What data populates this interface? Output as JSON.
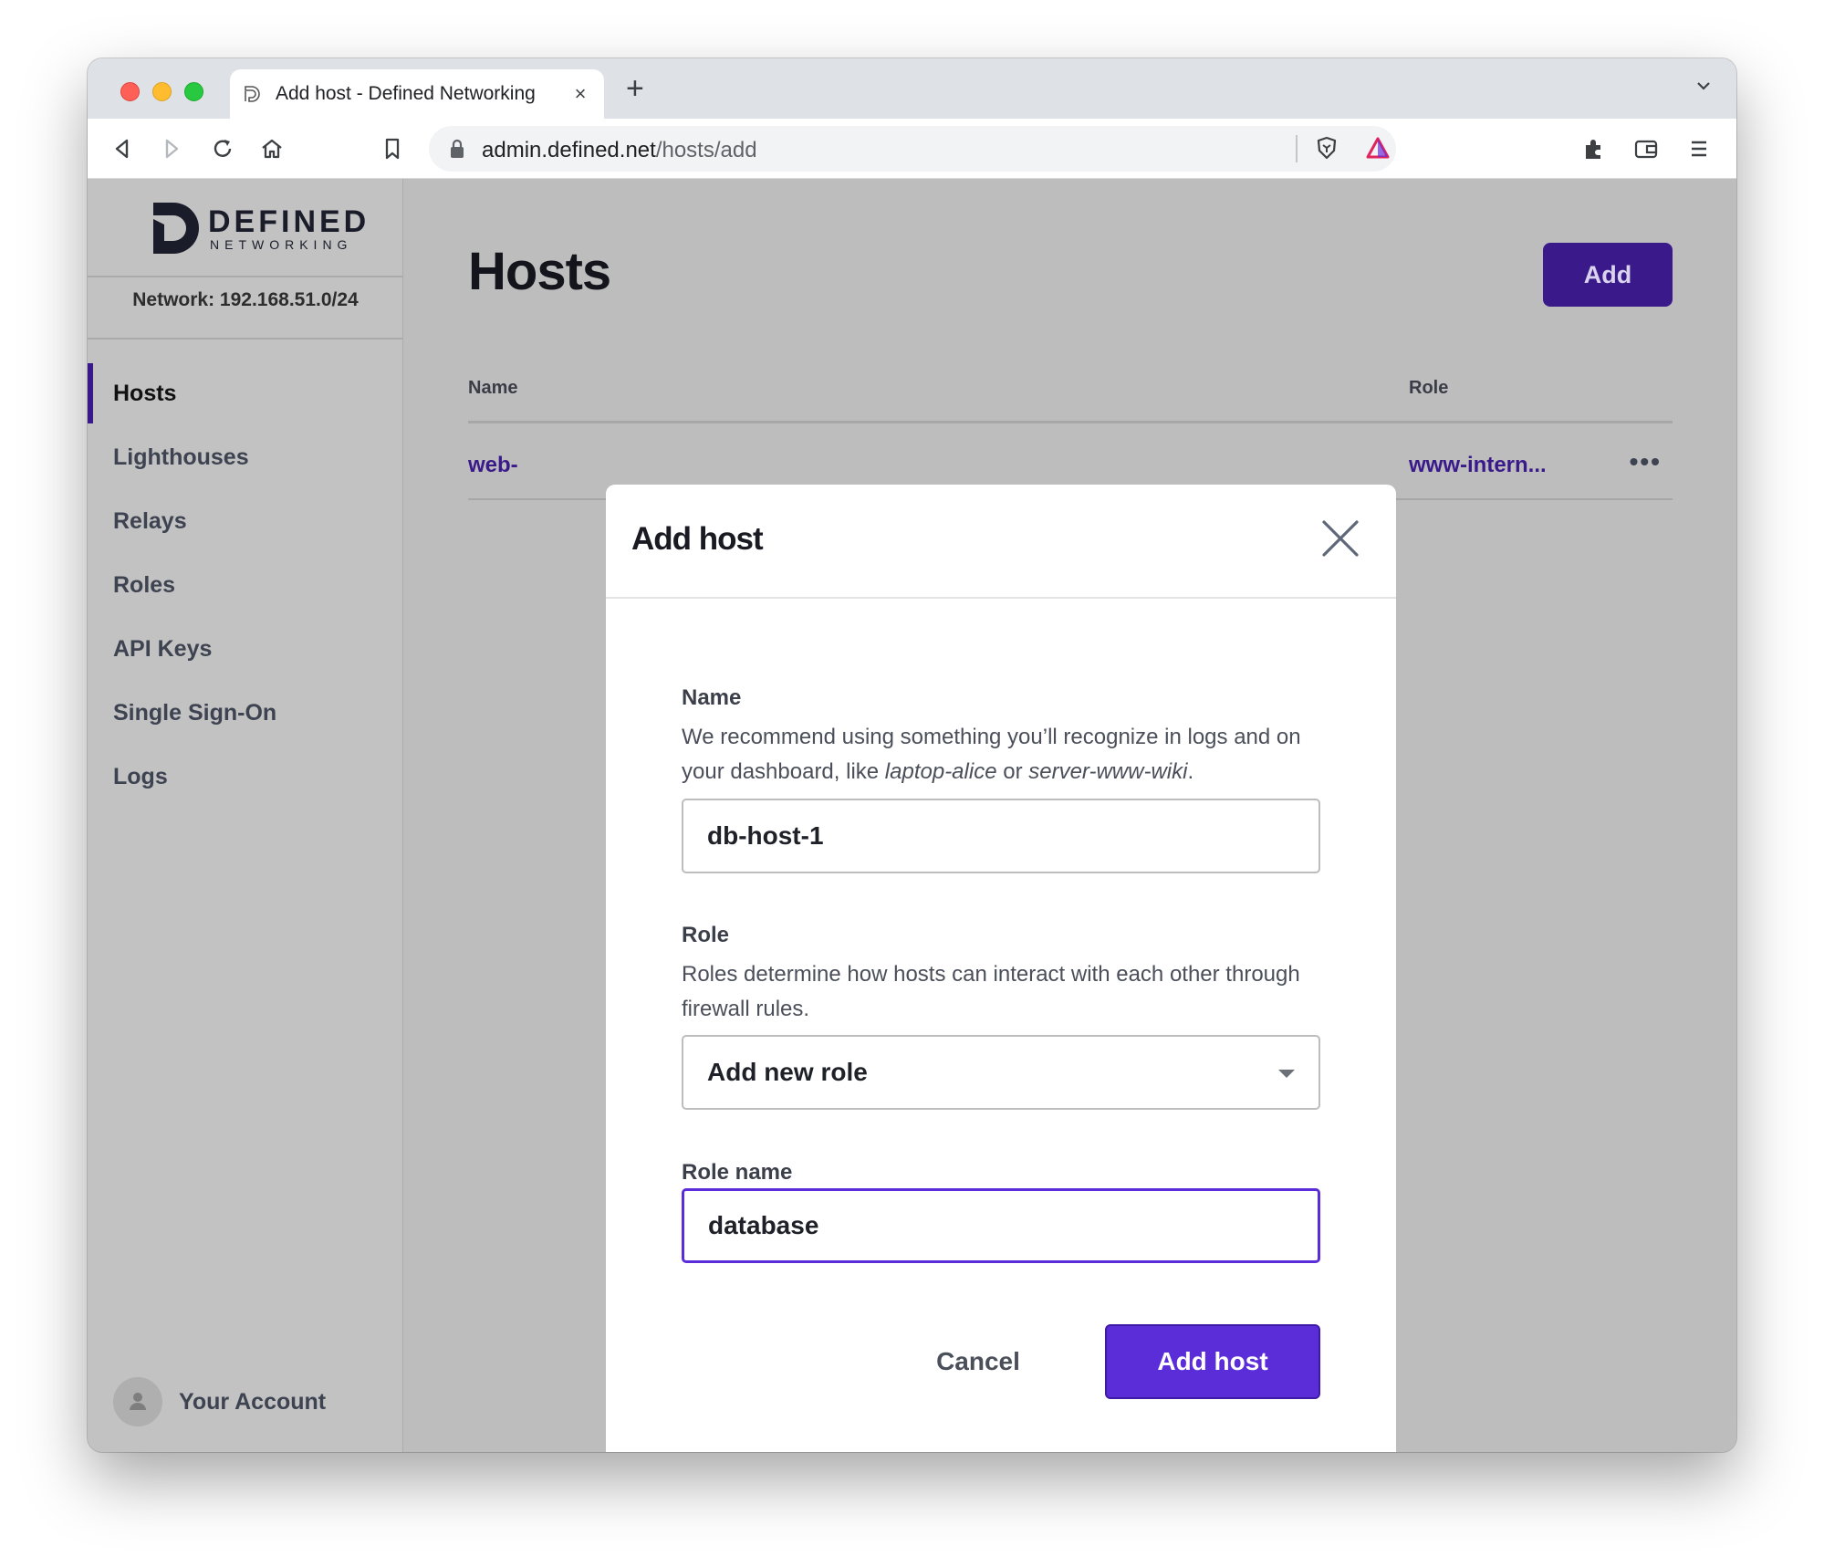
{
  "browser": {
    "tab_title": "Add host - Defined Networking",
    "tab_close": "×",
    "new_tab": "+",
    "url_host": "admin.defined.net",
    "url_path": "/hosts/add"
  },
  "sidebar": {
    "logo_word": "DEFINED",
    "logo_sub": "NETWORKING",
    "network_label": "Network: 192.168.51.0/24",
    "items": [
      {
        "label": "Hosts",
        "active": true
      },
      {
        "label": "Lighthouses"
      },
      {
        "label": "Relays"
      },
      {
        "label": "Roles"
      },
      {
        "label": "API Keys"
      },
      {
        "label": "Single Sign-On"
      },
      {
        "label": "Logs"
      }
    ],
    "account_label": "Your Account"
  },
  "page": {
    "title": "Hosts",
    "add_label": "Add",
    "columns": {
      "name": "Name",
      "role": "Role"
    },
    "rows": [
      {
        "name": "web-",
        "role": "www-intern..."
      }
    ],
    "row_more": "•••"
  },
  "modal": {
    "title": "Add host",
    "name_label": "Name",
    "name_help_1": "We recommend using something you’ll recognize in logs and on your dashboard, like ",
    "name_help_ex1": "laptop-alice",
    "name_help_or": " or ",
    "name_help_ex2": "server-www-wiki",
    "name_help_end": ".",
    "name_value": "db-host-1",
    "role_label": "Role",
    "role_help": "Roles determine how hosts can interact with each other through firewall rules.",
    "role_selected": "Add new role",
    "role_name_label": "Role name",
    "role_name_value": "database",
    "cancel_label": "Cancel",
    "submit_label": "Add host"
  },
  "colors": {
    "accent": "#5b2dd8",
    "brand_dark": "#3a1a8a"
  }
}
